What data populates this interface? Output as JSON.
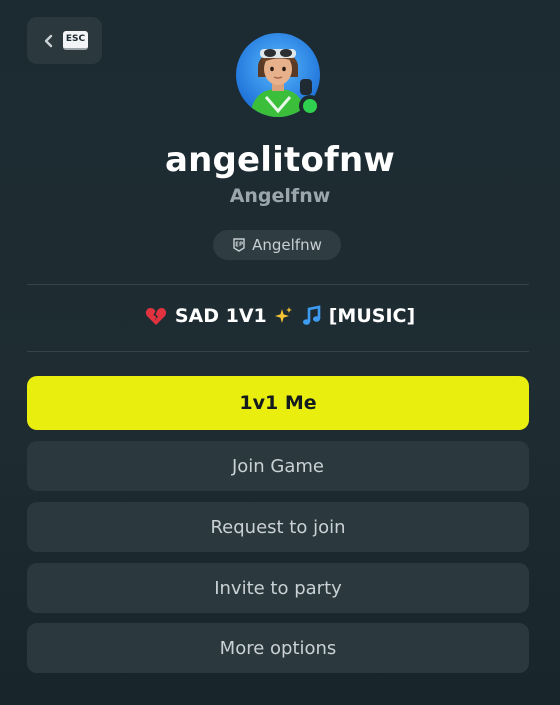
{
  "back_button": {
    "key_label": "ESC"
  },
  "profile": {
    "display_name": "angelitofnw",
    "username": "Angelfnw",
    "platform": {
      "icon": "epic-games-icon",
      "name": "Angelfnw"
    },
    "online": true,
    "status": {
      "prefix_icon": "broken-heart-icon",
      "text_main": "SAD 1V1",
      "mid_icons": [
        "sparkles-icon",
        "music-note-icon"
      ],
      "text_tail": "[MUSIC]"
    }
  },
  "actions": {
    "primary": "1v1 Me",
    "join_game": "Join Game",
    "request_join": "Request to join",
    "invite_party": "Invite to party",
    "more_options": "More options"
  },
  "colors": {
    "accent": "#e9ee0f",
    "online": "#2fd04f",
    "panel": "#2b393f",
    "background": "#1e2c32"
  }
}
